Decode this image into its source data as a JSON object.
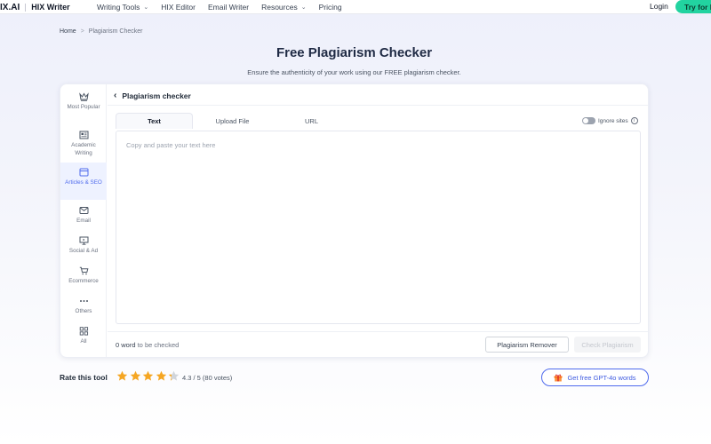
{
  "nav": {
    "logo": "IX.AI",
    "product": "HIX Writer",
    "links": [
      {
        "label": "Writing Tools",
        "dropdown": true
      },
      {
        "label": "HIX Editor",
        "dropdown": false
      },
      {
        "label": "Email Writer",
        "dropdown": false
      },
      {
        "label": "Resources",
        "dropdown": true
      },
      {
        "label": "Pricing",
        "dropdown": false
      }
    ],
    "login": "Login",
    "cta": "Try for F"
  },
  "breadcrumb": {
    "home": "Home",
    "separator": ">",
    "current": "Plagiarism Checker"
  },
  "page": {
    "title": "Free Plagiarism Checker",
    "subtitle": "Ensure the authenticity of your work using our FREE plagiarism checker."
  },
  "sidebar": {
    "items": [
      {
        "label": "Most Popular",
        "icon": "crown-icon",
        "active": false
      },
      {
        "label": "Academic Writing",
        "icon": "newspaper-icon",
        "active": false
      },
      {
        "label": "Articles & SEO",
        "icon": "browser-window-icon",
        "active": true
      },
      {
        "label": "Email",
        "icon": "envelope-icon",
        "active": false
      },
      {
        "label": "Social & Ad",
        "icon": "monitor-icon",
        "active": false
      },
      {
        "label": "Ecommerce",
        "icon": "cart-icon",
        "active": false
      },
      {
        "label": "Others",
        "icon": "ellipsis-icon",
        "active": false
      },
      {
        "label": "All",
        "icon": "grid-icon",
        "active": false
      }
    ]
  },
  "tool": {
    "title": "Plagiarism checker",
    "tabs": [
      {
        "label": "Text",
        "active": true
      },
      {
        "label": "Upload File",
        "active": false
      },
      {
        "label": "URL",
        "active": false
      }
    ],
    "ignore_sites_label": "Ignore sites",
    "ignore_sites_on": false,
    "info_glyph": "i",
    "text_placeholder": "Copy and paste your text here",
    "word_count": "0 word",
    "word_count_suffix": " to be checked",
    "remover_button": "Plagiarism Remover",
    "check_button": "Check Plagiarism"
  },
  "rating": {
    "label": "Rate this tool",
    "score": 4.3,
    "max": 5,
    "text": "4.3 / 5 (80 votes)"
  },
  "promo": {
    "button": "Get free GPT-4o words",
    "icon": "gift-icon"
  },
  "colors": {
    "accent": "#4f6bed",
    "cta": "#22d3a0",
    "star": "#f5a623"
  }
}
